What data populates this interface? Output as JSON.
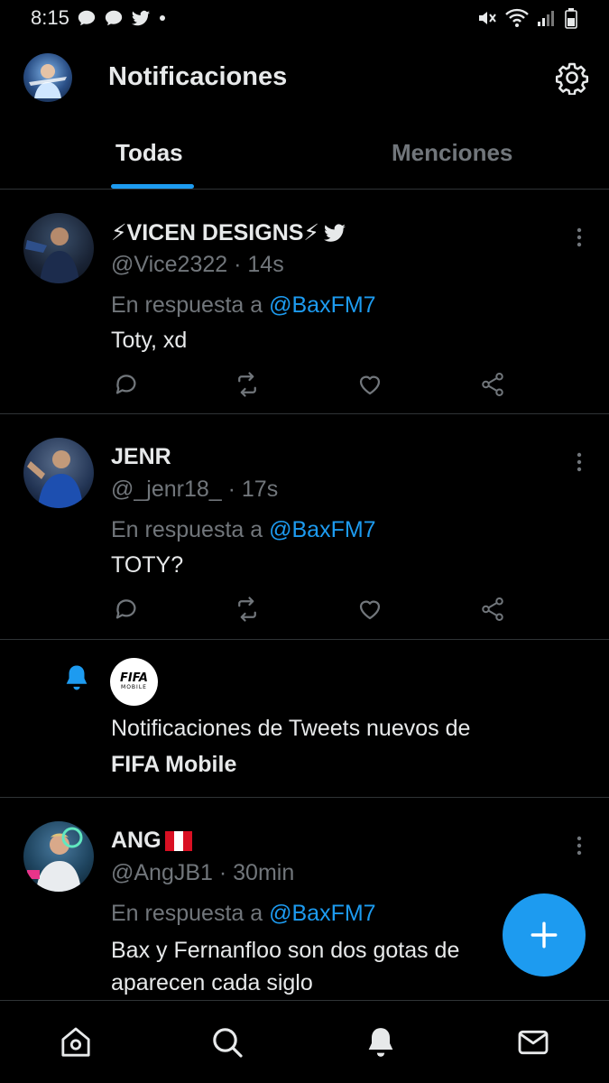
{
  "status_bar": {
    "time": "8:15"
  },
  "header": {
    "title": "Notificaciones"
  },
  "tabs": [
    {
      "label": "Todas",
      "active": true
    },
    {
      "label": "Menciones",
      "active": false
    }
  ],
  "tweets": [
    {
      "name": "⚡VICEN DESIGNS⚡",
      "handle_time": "@Vice2322 · 14s",
      "reply_prefix": "En respuesta a ",
      "reply_to": "@BaxFM7",
      "text": "Toty, xd"
    },
    {
      "name": "JENR",
      "handle_time": "@_jenr18_ · 17s",
      "reply_prefix": "En respuesta a ",
      "reply_to": "@BaxFM7",
      "text": "TOTY?"
    },
    {
      "name": "ANG",
      "handle_time": "@AngJB1 · 30min",
      "reply_prefix": "En respuesta a ",
      "reply_to": "@BaxFM7",
      "text_line1": "Bax y Fernanfloo son dos gotas de",
      "text_line2": "aparecen cada siglo"
    }
  ],
  "notification": {
    "text": "Notificaciones de Tweets nuevos de",
    "account": "FIFA Mobile",
    "logo_text": "FIFA",
    "logo_subtext": "MOBILE"
  },
  "colors": {
    "accent": "#1d9bf0",
    "background": "#000000",
    "secondary_text": "#71767b"
  }
}
